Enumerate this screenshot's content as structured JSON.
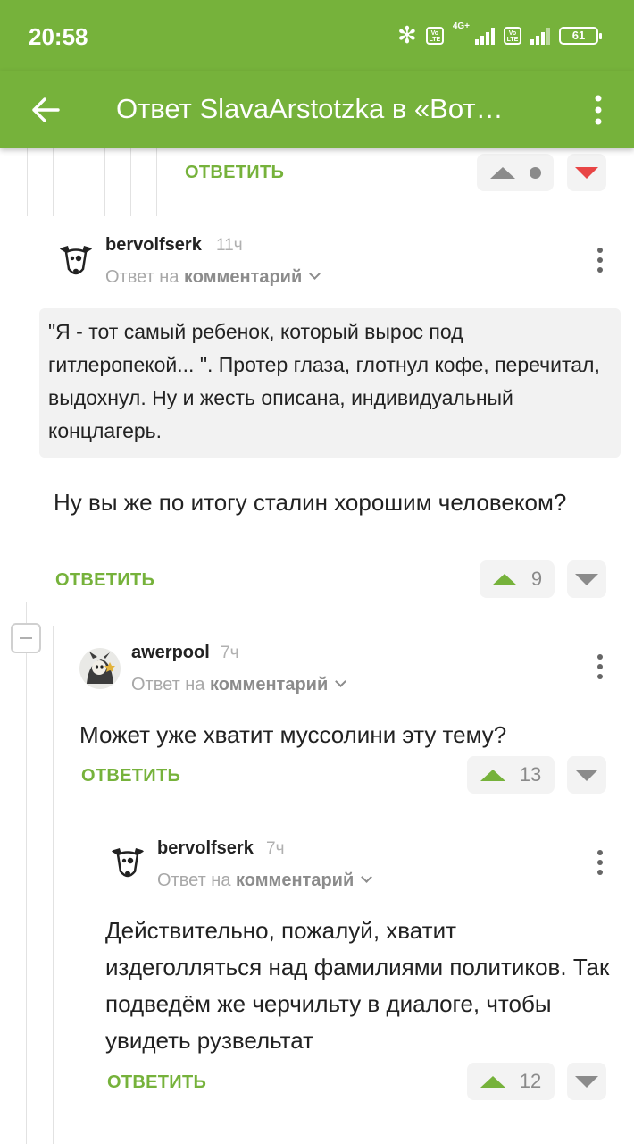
{
  "status_bar": {
    "time": "20:58",
    "network": "4G+",
    "volte_1": "Vo LTE",
    "volte_2": "Vo LTE",
    "battery": "61"
  },
  "app_bar": {
    "title": "Ответ SlavaArstotzka в «Вот…",
    "back_icon": "arrow-left-icon",
    "menu_icon": "more-vertical-icon"
  },
  "colors": {
    "accent": "#76b23b",
    "downvote_active": "#e84545",
    "quote_bg": "#f2f2f2"
  },
  "reply_label": "ОТВЕТИТЬ",
  "top_partial": {
    "reply_label": "ОТВЕТИТЬ",
    "vote_state": "neutral-dot",
    "downvote_active": true
  },
  "comments": [
    {
      "author": "bervolfserk",
      "time": "11ч",
      "reply_prefix": "Ответ на",
      "reply_target": "комментарий",
      "quote": "\"Я - тот самый ребенок, который вырос под гитлеропекой... \". Протер глаза, глотнул кофе, перечитал, выдохнул. Ну и жесть описана, индивидуальный концлагерь.",
      "text": "Ну вы же по итогу сталин хорошим человеком?",
      "rating": "9",
      "reply_label": "ОТВЕТИТЬ"
    },
    {
      "author": "awerpool",
      "time": "7ч",
      "reply_prefix": "Ответ на",
      "reply_target": "комментарий",
      "text": "Может уже хватит муссолини эту тему?",
      "rating": "13",
      "reply_label": "ОТВЕТИТЬ"
    },
    {
      "author": "bervolfserk",
      "time": "7ч",
      "reply_prefix": "Ответ на",
      "reply_target": "комментарий",
      "text": "Действительно, пожалуй, хватит издеголляться над фамилиями политиков. Так подведём же черчильту в диалоге, чтобы увидеть рузвельтат",
      "rating": "12",
      "reply_label": "ОТВЕТИТЬ"
    }
  ]
}
